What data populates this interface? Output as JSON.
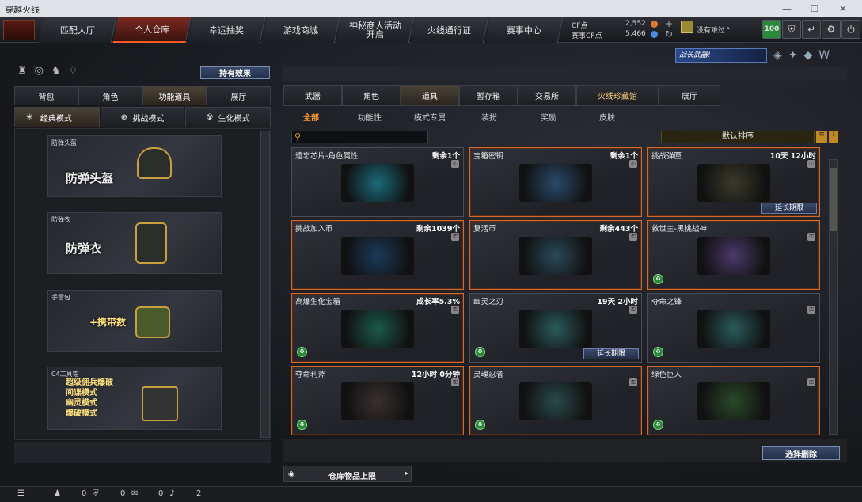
{
  "window": {
    "title": "穿越火线",
    "controls": [
      "—",
      "☐",
      "✕"
    ]
  },
  "topnav": {
    "tabs": [
      "匹配大厅",
      "个人仓库",
      "幸运抽奖",
      "游戏商城",
      "神秘商人活动开启",
      "火线通行证",
      "赛事中心"
    ],
    "active_index": 1,
    "cf_label": "CF点",
    "cf_value": "2,552",
    "cf_extra": "赛事CF点",
    "cf_extra_value": "5,466",
    "rank_text": "没有难过^",
    "level": "100"
  },
  "left": {
    "effect_button": "持有效果",
    "tabs": [
      "背包",
      "角色",
      "功能道具",
      "展厅"
    ],
    "active_tab": 2,
    "modes": [
      "经典模式",
      "挑战模式",
      "生化模式"
    ],
    "active_mode": 0,
    "cards": [
      {
        "cap": "防弹头盔",
        "big": "防弹头盔"
      },
      {
        "cap": "防弹衣",
        "big": "防弹衣"
      },
      {
        "cap": "手雷包",
        "big": "+携带数"
      },
      {
        "cap": "C4工具钳",
        "big": "超级佣兵爆破\n间谍模式\n幽灵模式\n爆破模式"
      }
    ]
  },
  "right": {
    "banner": "战长武器!",
    "tabs": [
      "武器",
      "角色",
      "道具",
      "暂存箱",
      "交易所",
      "火线珍藏馆",
      "展厅"
    ],
    "active_tab": 2,
    "subtabs": [
      "全部",
      "功能性",
      "模式专属",
      "装扮",
      "奖励",
      "皮肤"
    ],
    "active_sub": 0,
    "search_placeholder": "",
    "sort_label": "默认排序",
    "items": [
      {
        "name": "遗忘芯片-角色属性",
        "stat": "剩余1个",
        "orange": false
      },
      {
        "name": "宝箱密钥",
        "stat": "剩余1个",
        "orange": true
      },
      {
        "name": "挑战弹匣",
        "stat": "10天 12小时",
        "orange": true,
        "ext": "延长期限"
      },
      {
        "name": "挑战加入币",
        "stat": "剩余1039个",
        "orange": true
      },
      {
        "name": "复活币",
        "stat": "剩余443个",
        "orange": true
      },
      {
        "name": "救世主-黑桃战神",
        "stat": "",
        "orange": true
      },
      {
        "name": "高爆生化宝箱",
        "stat": "成长率5.3%",
        "orange": true
      },
      {
        "name": "幽灵之刃",
        "stat": "19天 2小时",
        "orange": false,
        "ext": "延长期限"
      },
      {
        "name": "夺命之锋",
        "stat": "",
        "orange": false
      },
      {
        "name": "夺命利斧",
        "stat": "12小时 0分钟",
        "orange": true
      },
      {
        "name": "灵魂忍者",
        "stat": "",
        "orange": true
      },
      {
        "name": "绿色巨人",
        "stat": "",
        "orange": true
      }
    ],
    "select_delete": "选择删除",
    "capacity_label": "仓库物品上限"
  },
  "status": {
    "items": [
      "0",
      "0",
      "0",
      "2"
    ]
  }
}
